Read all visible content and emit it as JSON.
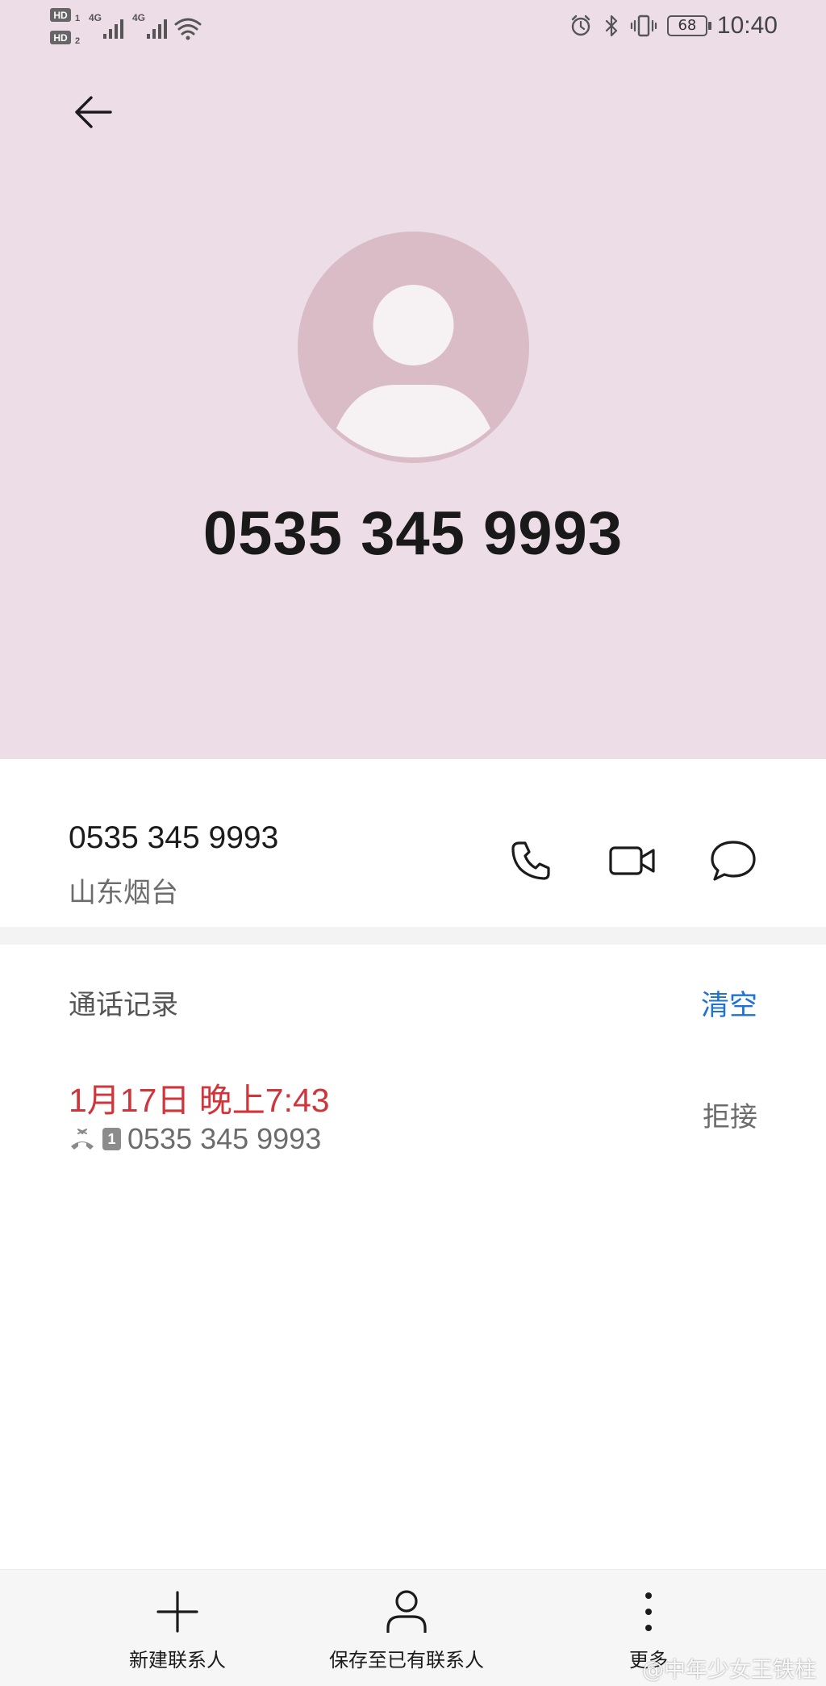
{
  "status_bar": {
    "sim1_label": "HD",
    "sim1_index": "1",
    "sim2_label": "HD",
    "sim2_index": "2",
    "network1": "4G",
    "network2": "4G",
    "battery_level": "68",
    "time": "10:40",
    "icons": [
      "hd-icon",
      "signal-icon",
      "wifi-icon",
      "alarm-icon",
      "bluetooth-icon",
      "vibrate-icon",
      "battery-icon"
    ]
  },
  "header": {
    "back_icon": "arrow-left-icon",
    "avatar_icon": "person-avatar-icon",
    "phone_number": "0535 345 9993",
    "background_color": "#ecdde6"
  },
  "contact": {
    "number": "0535 345 9993",
    "location": "山东烟台",
    "actions": [
      {
        "name": "call",
        "icon": "phone-icon"
      },
      {
        "name": "video-call",
        "icon": "video-camera-icon"
      },
      {
        "name": "message",
        "icon": "chat-bubble-icon"
      }
    ]
  },
  "call_log": {
    "title": "通话记录",
    "clear_label": "清空",
    "clear_color": "#1d72d2",
    "entries": [
      {
        "datetime": "1月17日 晚上7:43",
        "number": "0535 345 9993",
        "status": "拒接",
        "sim": "1",
        "call_icon": "rejected-call-icon",
        "datetime_color": "#d0353b"
      }
    ]
  },
  "bottom_bar": {
    "items": [
      {
        "label": "新建联系人",
        "icon": "plus-icon"
      },
      {
        "label": "保存至已有联系人",
        "icon": "person-icon"
      },
      {
        "label": "更多",
        "icon": "more-vertical-icon"
      }
    ]
  },
  "watermark": "@中年少女王铁柱"
}
